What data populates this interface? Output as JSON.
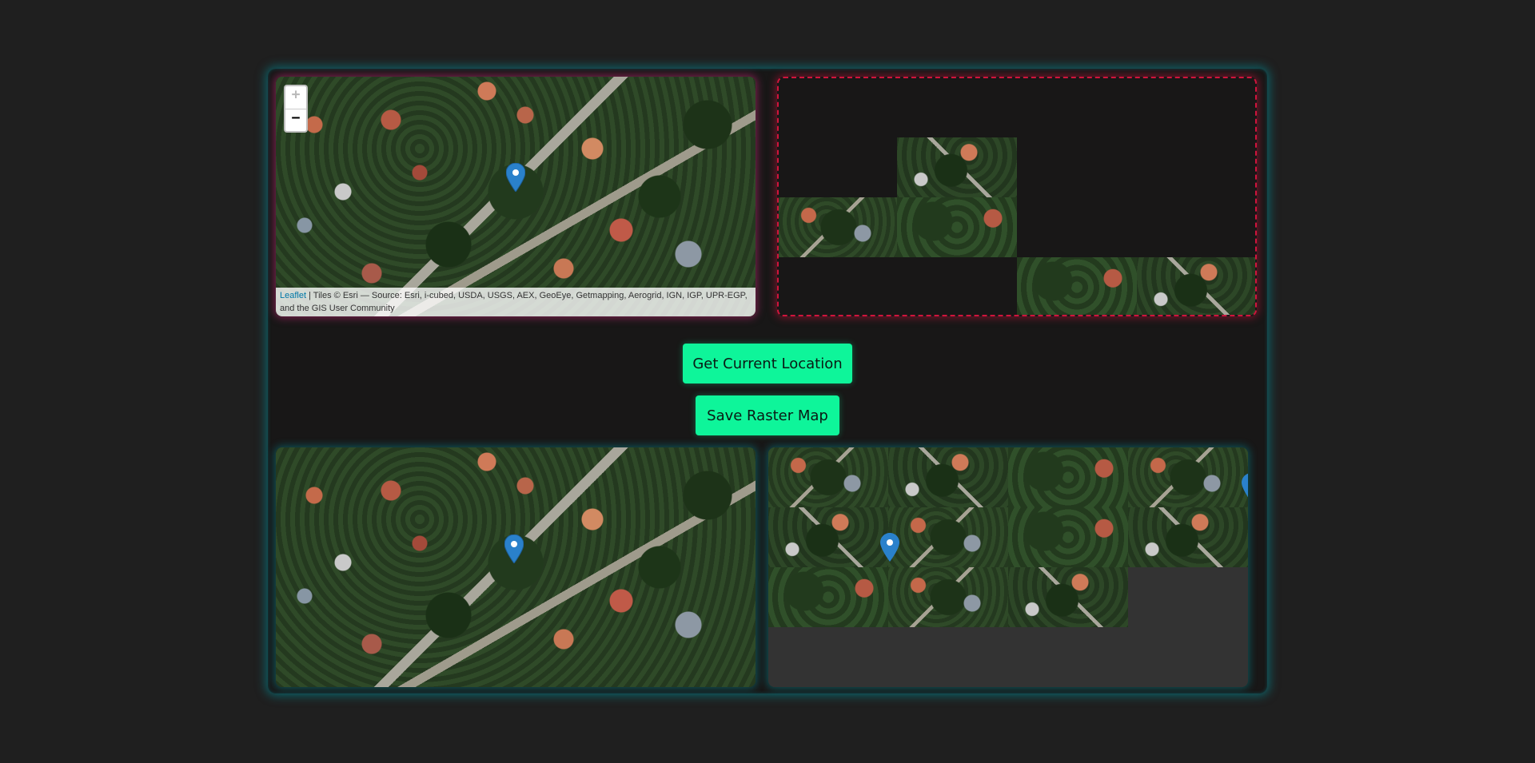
{
  "map": {
    "zoom_in": "+",
    "zoom_out": "−",
    "attribution_link": "Leaflet",
    "attribution_text": " | Tiles © Esri — Source: Esri, i-cubed, USDA, USGS, AEX, GeoEye, Getmapping, Aerogrid, IGN, IGP, UPR-EGP, and the GIS User Community"
  },
  "buttons": {
    "get_location": "Get Current Location",
    "save_raster": "Save Raster Map"
  },
  "colors": {
    "accent": "#0ef59a",
    "marker": "#2a81cb",
    "puzzle_border": "#d0143c",
    "frame_glow": "#00a0aa"
  },
  "icons": {
    "marker": "map-marker-icon"
  }
}
